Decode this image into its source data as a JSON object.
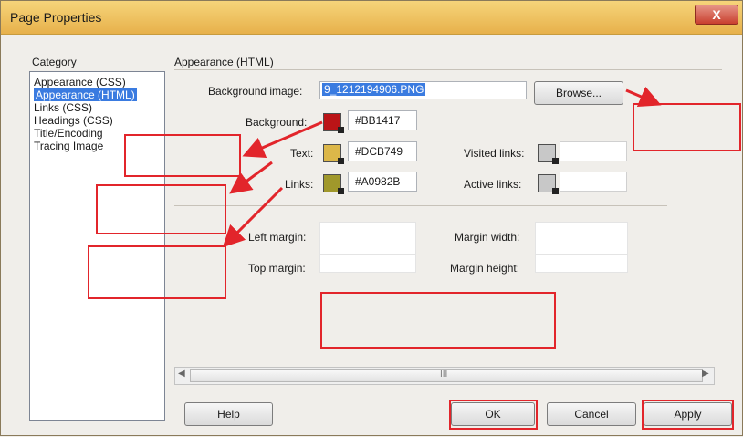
{
  "window": {
    "title": "Page Properties",
    "close_label": "X"
  },
  "category": {
    "header": "Category",
    "items": [
      "Appearance (CSS)",
      "Appearance (HTML)",
      "Links (CSS)",
      "Headings (CSS)",
      "Title/Encoding",
      "Tracing Image"
    ]
  },
  "panel": {
    "header": "Appearance (HTML)",
    "bg_image_label": "Background image:",
    "bg_image_value": "9_1212194906.PNG",
    "browse_label": "Browse...",
    "background_label": "Background:",
    "background_value": "#BB1417",
    "text_label": "Text:",
    "text_value": "#DCB749",
    "links_label": "Links:",
    "links_value": "#A0982B",
    "visited_label": "Visited links:",
    "active_label": "Active links:",
    "left_margin_label": "Left margin:",
    "top_margin_label": "Top margin:",
    "margin_width_label": "Margin width:",
    "margin_height_label": "Margin height:",
    "colors": {
      "background": "#BB1417",
      "text": "#DCB749",
      "links": "#A0982B",
      "visited": "#c8c8c8",
      "active": "#c8c8c8"
    }
  },
  "scroll": {
    "center_mark": "III"
  },
  "footer": {
    "help": "Help",
    "ok": "OK",
    "cancel": "Cancel",
    "apply": "Apply"
  }
}
